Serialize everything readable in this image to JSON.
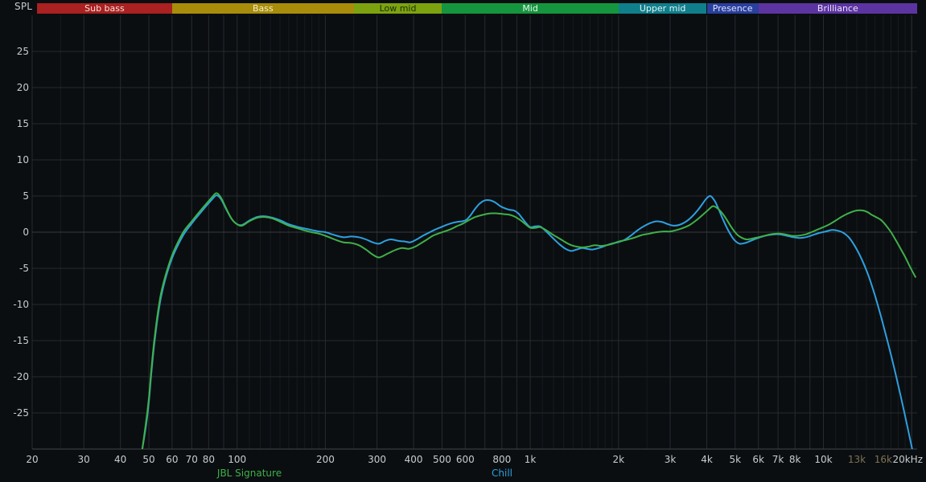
{
  "chart_data": {
    "type": "line",
    "x_scale": "log",
    "x_unit": "Hz",
    "y_unit": "dB SPL",
    "y_axis_title": "SPL",
    "x_range": [
      20,
      20900
    ],
    "y_range": [
      -30,
      30
    ],
    "grid": true,
    "legend_position": "bottom",
    "y_ticks": [
      -25,
      -20,
      -15,
      -10,
      -5,
      0,
      5,
      10,
      15,
      20,
      25
    ],
    "x_ticks": [
      {
        "f": 20,
        "label": "20",
        "dim": false
      },
      {
        "f": 30,
        "label": "30",
        "dim": false
      },
      {
        "f": 40,
        "label": "40",
        "dim": false
      },
      {
        "f": 50,
        "label": "50",
        "dim": false
      },
      {
        "f": 60,
        "label": "60",
        "dim": false
      },
      {
        "f": 70,
        "label": "70",
        "dim": false
      },
      {
        "f": 80,
        "label": "80",
        "dim": false
      },
      {
        "f": 100,
        "label": "100",
        "dim": false
      },
      {
        "f": 200,
        "label": "200",
        "dim": false
      },
      {
        "f": 300,
        "label": "300",
        "dim": false
      },
      {
        "f": 400,
        "label": "400",
        "dim": false
      },
      {
        "f": 500,
        "label": "500",
        "dim": false
      },
      {
        "f": 600,
        "label": "600",
        "dim": false
      },
      {
        "f": 800,
        "label": "800",
        "dim": false
      },
      {
        "f": 1000,
        "label": "1k",
        "dim": false
      },
      {
        "f": 2000,
        "label": "2k",
        "dim": false
      },
      {
        "f": 3000,
        "label": "3k",
        "dim": false
      },
      {
        "f": 4000,
        "label": "4k",
        "dim": false
      },
      {
        "f": 5000,
        "label": "5k",
        "dim": false
      },
      {
        "f": 6000,
        "label": "6k",
        "dim": false
      },
      {
        "f": 7000,
        "label": "7k",
        "dim": false
      },
      {
        "f": 8000,
        "label": "8k",
        "dim": false
      },
      {
        "f": 10000,
        "label": "10k",
        "dim": false
      },
      {
        "f": 13000,
        "label": "13k",
        "dim": true
      },
      {
        "f": 16000,
        "label": "16k",
        "dim": true
      },
      {
        "f": 20000,
        "label": "20kHz",
        "dim": false
      }
    ],
    "series": [
      {
        "name": "JBL Signature",
        "color": "#3fb04a",
        "points": [
          [
            47.5,
            -30
          ],
          [
            49,
            -26
          ],
          [
            50,
            -23
          ],
          [
            51,
            -19
          ],
          [
            52,
            -15.5
          ],
          [
            53.5,
            -11.5
          ],
          [
            55,
            -8.5
          ],
          [
            57,
            -6
          ],
          [
            60,
            -3.2
          ],
          [
            63,
            -1.3
          ],
          [
            66,
            0.2
          ],
          [
            70,
            1.5
          ],
          [
            74,
            2.7
          ],
          [
            78,
            3.8
          ],
          [
            82,
            4.8
          ],
          [
            85,
            5.4
          ],
          [
            88,
            4.8
          ],
          [
            92,
            3.2
          ],
          [
            96,
            1.8
          ],
          [
            100,
            1.1
          ],
          [
            104,
            0.9
          ],
          [
            110,
            1.5
          ],
          [
            117,
            2
          ],
          [
            124,
            2.1
          ],
          [
            132,
            1.9
          ],
          [
            141,
            1.4
          ],
          [
            150,
            0.9
          ],
          [
            162,
            0.5
          ],
          [
            175,
            0.1
          ],
          [
            190,
            -0.2
          ],
          [
            200,
            -0.5
          ],
          [
            215,
            -1
          ],
          [
            230,
            -1.4
          ],
          [
            245,
            -1.5
          ],
          [
            260,
            -1.8
          ],
          [
            275,
            -2.4
          ],
          [
            290,
            -3.1
          ],
          [
            305,
            -3.5
          ],
          [
            325,
            -3
          ],
          [
            345,
            -2.5
          ],
          [
            365,
            -2.2
          ],
          [
            385,
            -2.3
          ],
          [
            405,
            -2
          ],
          [
            425,
            -1.5
          ],
          [
            445,
            -1
          ],
          [
            465,
            -0.5
          ],
          [
            485,
            -0.2
          ],
          [
            510,
            0.1
          ],
          [
            535,
            0.4
          ],
          [
            560,
            0.8
          ],
          [
            590,
            1.2
          ],
          [
            620,
            1.7
          ],
          [
            650,
            2.1
          ],
          [
            690,
            2.4
          ],
          [
            730,
            2.6
          ],
          [
            770,
            2.6
          ],
          [
            810,
            2.5
          ],
          [
            850,
            2.4
          ],
          [
            890,
            2.1
          ],
          [
            930,
            1.6
          ],
          [
            970,
            1
          ],
          [
            1000,
            0.6
          ],
          [
            1040,
            0.6
          ],
          [
            1080,
            0.7
          ],
          [
            1120,
            0.4
          ],
          [
            1160,
            0
          ],
          [
            1200,
            -0.4
          ],
          [
            1260,
            -0.9
          ],
          [
            1320,
            -1.4
          ],
          [
            1380,
            -1.8
          ],
          [
            1440,
            -2
          ],
          [
            1510,
            -2.1
          ],
          [
            1580,
            -2
          ],
          [
            1660,
            -1.8
          ],
          [
            1740,
            -1.9
          ],
          [
            1820,
            -1.8
          ],
          [
            1910,
            -1.6
          ],
          [
            2000,
            -1.3
          ],
          [
            2110,
            -1.1
          ],
          [
            2250,
            -0.8
          ],
          [
            2400,
            -0.4
          ],
          [
            2550,
            -0.2
          ],
          [
            2700,
            0
          ],
          [
            2850,
            0.1
          ],
          [
            3000,
            0.1
          ],
          [
            3160,
            0.3
          ],
          [
            3330,
            0.6
          ],
          [
            3500,
            1
          ],
          [
            3700,
            1.7
          ],
          [
            3900,
            2.5
          ],
          [
            4050,
            3.1
          ],
          [
            4200,
            3.6
          ],
          [
            4350,
            3.3
          ],
          [
            4500,
            2.7
          ],
          [
            4650,
            1.9
          ],
          [
            4800,
            1
          ],
          [
            4950,
            0.2
          ],
          [
            5100,
            -0.4
          ],
          [
            5280,
            -0.8
          ],
          [
            5470,
            -1
          ],
          [
            5700,
            -0.9
          ],
          [
            6000,
            -0.7
          ],
          [
            6300,
            -0.5
          ],
          [
            6600,
            -0.3
          ],
          [
            7000,
            -0.2
          ],
          [
            7400,
            -0.3
          ],
          [
            7800,
            -0.5
          ],
          [
            8200,
            -0.5
          ],
          [
            8700,
            -0.3
          ],
          [
            9100,
            0
          ],
          [
            9600,
            0.4
          ],
          [
            10000,
            0.7
          ],
          [
            10500,
            1.1
          ],
          [
            11000,
            1.6
          ],
          [
            11500,
            2.1
          ],
          [
            12000,
            2.5
          ],
          [
            12500,
            2.8
          ],
          [
            13000,
            3
          ],
          [
            13600,
            3
          ],
          [
            14100,
            2.8
          ],
          [
            14600,
            2.4
          ],
          [
            15100,
            2.1
          ],
          [
            15700,
            1.7
          ],
          [
            16300,
            1
          ],
          [
            17000,
            0
          ],
          [
            17700,
            -1.2
          ],
          [
            18400,
            -2.4
          ],
          [
            19100,
            -3.6
          ],
          [
            19800,
            -4.9
          ],
          [
            20600,
            -6.2
          ]
        ]
      },
      {
        "name": "Chill",
        "color": "#2da0e0",
        "points": [
          [
            47.5,
            -30
          ],
          [
            49,
            -26.5
          ],
          [
            50,
            -23.5
          ],
          [
            51,
            -19.5
          ],
          [
            52,
            -16
          ],
          [
            53.5,
            -12
          ],
          [
            55,
            -9
          ],
          [
            57,
            -6.4
          ],
          [
            60,
            -3.6
          ],
          [
            63,
            -1.7
          ],
          [
            66,
            -0.2
          ],
          [
            70,
            1.2
          ],
          [
            74,
            2.4
          ],
          [
            78,
            3.5
          ],
          [
            82,
            4.5
          ],
          [
            85,
            5.1
          ],
          [
            88,
            4.6
          ],
          [
            92,
            3.1
          ],
          [
            96,
            1.8
          ],
          [
            100,
            1.1
          ],
          [
            104,
            1
          ],
          [
            110,
            1.6
          ],
          [
            117,
            2.1
          ],
          [
            124,
            2.2
          ],
          [
            132,
            2
          ],
          [
            141,
            1.6
          ],
          [
            150,
            1.1
          ],
          [
            162,
            0.7
          ],
          [
            175,
            0.4
          ],
          [
            190,
            0.1
          ],
          [
            200,
            0
          ],
          [
            215,
            -0.4
          ],
          [
            230,
            -0.7
          ],
          [
            245,
            -0.6
          ],
          [
            260,
            -0.7
          ],
          [
            275,
            -1
          ],
          [
            290,
            -1.4
          ],
          [
            305,
            -1.6
          ],
          [
            320,
            -1.2
          ],
          [
            335,
            -1
          ],
          [
            355,
            -1.2
          ],
          [
            375,
            -1.3
          ],
          [
            390,
            -1.4
          ],
          [
            410,
            -1
          ],
          [
            430,
            -0.5
          ],
          [
            450,
            -0.1
          ],
          [
            470,
            0.3
          ],
          [
            490,
            0.6
          ],
          [
            510,
            0.9
          ],
          [
            535,
            1.2
          ],
          [
            560,
            1.4
          ],
          [
            585,
            1.5
          ],
          [
            605,
            1.7
          ],
          [
            625,
            2.3
          ],
          [
            645,
            3.1
          ],
          [
            670,
            3.9
          ],
          [
            700,
            4.4
          ],
          [
            730,
            4.4
          ],
          [
            760,
            4.1
          ],
          [
            790,
            3.6
          ],
          [
            820,
            3.3
          ],
          [
            850,
            3.1
          ],
          [
            880,
            3
          ],
          [
            910,
            2.6
          ],
          [
            940,
            1.9
          ],
          [
            970,
            1.2
          ],
          [
            1000,
            0.7
          ],
          [
            1040,
            0.8
          ],
          [
            1080,
            0.8
          ],
          [
            1120,
            0.3
          ],
          [
            1160,
            -0.3
          ],
          [
            1200,
            -0.9
          ],
          [
            1260,
            -1.7
          ],
          [
            1320,
            -2.3
          ],
          [
            1380,
            -2.6
          ],
          [
            1440,
            -2.4
          ],
          [
            1500,
            -2.2
          ],
          [
            1560,
            -2.3
          ],
          [
            1630,
            -2.4
          ],
          [
            1710,
            -2.2
          ],
          [
            1800,
            -1.9
          ],
          [
            1890,
            -1.6
          ],
          [
            1990,
            -1.4
          ],
          [
            2090,
            -1.1
          ],
          [
            2200,
            -0.5
          ],
          [
            2330,
            0.3
          ],
          [
            2460,
            0.9
          ],
          [
            2580,
            1.3
          ],
          [
            2700,
            1.5
          ],
          [
            2820,
            1.4
          ],
          [
            2950,
            1.1
          ],
          [
            3080,
            0.9
          ],
          [
            3220,
            1
          ],
          [
            3380,
            1.4
          ],
          [
            3550,
            2.1
          ],
          [
            3720,
            3
          ],
          [
            3880,
            4
          ],
          [
            4000,
            4.7
          ],
          [
            4120,
            5
          ],
          [
            4260,
            4.3
          ],
          [
            4400,
            3.1
          ],
          [
            4550,
            1.7
          ],
          [
            4700,
            0.5
          ],
          [
            4850,
            -0.5
          ],
          [
            5000,
            -1.2
          ],
          [
            5180,
            -1.6
          ],
          [
            5400,
            -1.5
          ],
          [
            5650,
            -1.2
          ],
          [
            5900,
            -0.9
          ],
          [
            6200,
            -0.6
          ],
          [
            6500,
            -0.4
          ],
          [
            6800,
            -0.3
          ],
          [
            7100,
            -0.3
          ],
          [
            7500,
            -0.5
          ],
          [
            7900,
            -0.7
          ],
          [
            8300,
            -0.8
          ],
          [
            8700,
            -0.7
          ],
          [
            9200,
            -0.4
          ],
          [
            9700,
            -0.1
          ],
          [
            10200,
            0.1
          ],
          [
            10700,
            0.3
          ],
          [
            11200,
            0.2
          ],
          [
            11700,
            -0.1
          ],
          [
            12200,
            -0.7
          ],
          [
            12700,
            -1.7
          ],
          [
            13200,
            -2.9
          ],
          [
            13700,
            -4.3
          ],
          [
            14300,
            -6.2
          ],
          [
            15000,
            -8.8
          ],
          [
            15700,
            -11.6
          ],
          [
            16400,
            -14.5
          ],
          [
            17200,
            -17.8
          ],
          [
            18000,
            -21.2
          ],
          [
            18800,
            -24.6
          ],
          [
            19600,
            -28
          ],
          [
            20200,
            -30.5
          ]
        ]
      }
    ]
  },
  "bands": [
    {
      "label": "Sub bass",
      "from_hz": 20,
      "to_hz": 60,
      "bg": "#ab2020",
      "fg": "#f2e2df"
    },
    {
      "label": "Bass",
      "from_hz": 60,
      "to_hz": 250,
      "bg": "#a88d0a",
      "fg": "#f4eecb"
    },
    {
      "label": "Low mid",
      "from_hz": 250,
      "to_hz": 500,
      "bg": "#7ca30f",
      "fg": "#1e2c09"
    },
    {
      "label": "Mid",
      "from_hz": 500,
      "to_hz": 2000,
      "bg": "#16953f",
      "fg": "#e9f7ee"
    },
    {
      "label": "Upper mid",
      "from_hz": 2000,
      "to_hz": 4000,
      "bg": "#107f8c",
      "fg": "#e2f3f5"
    },
    {
      "label": "Presence",
      "from_hz": 4000,
      "to_hz": 6000,
      "bg": "#2a3f9e",
      "fg": "#dde4f8"
    },
    {
      "label": "Brilliance",
      "from_hz": 6000,
      "to_hz": 20900,
      "bg": "#5c34a2",
      "fg": "#eae2f8"
    }
  ],
  "colors": {
    "background": "#0b0e10",
    "grid_major": "#262b2f",
    "grid_minor": "#171b1e",
    "grid_zero": "#343b40",
    "axis_line": "#40464c",
    "axis_text": "#c6ccd0",
    "axis_text_dim": "#7d7356"
  }
}
